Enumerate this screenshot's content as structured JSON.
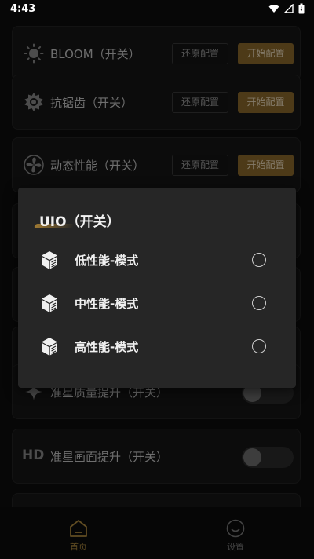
{
  "status_bar": {
    "time": "4:43"
  },
  "settings": [
    {
      "label": "BLOOM（开关）",
      "icon": "sun-icon",
      "reset_label": "还原配置",
      "start_label": "开始配置"
    },
    {
      "label": "抗锯齿（开关）",
      "icon": "gear-badge-icon",
      "reset_label": "还原配置",
      "start_label": "开始配置"
    },
    {
      "label": "动态性能（开关）",
      "icon": "fan-icon",
      "reset_label": "还原配置",
      "start_label": "开始配置"
    },
    {
      "label": "准星质量提升（开关）",
      "icon": "sparkle-icon",
      "toggle_on": false
    },
    {
      "label": "准星画面提升（开关）",
      "icon": "hd-icon",
      "icon_text": "HD",
      "toggle_on": false
    }
  ],
  "dialog": {
    "title": "UIO（开关）",
    "options": [
      {
        "label": "低性能-模式",
        "selected": false
      },
      {
        "label": "中性能-模式",
        "selected": false
      },
      {
        "label": "高性能-模式",
        "selected": false
      }
    ]
  },
  "bottom_nav": [
    {
      "label": "首页",
      "icon": "home-icon",
      "active": true,
      "color": "#b08a3e"
    },
    {
      "label": "设置",
      "icon": "smiley-icon",
      "active": false,
      "color": "#7a7a7a"
    }
  ],
  "colors": {
    "accent": "#8c6a2c",
    "background": "#0e0e0e",
    "card": "#161616",
    "dialog": "#262626"
  }
}
